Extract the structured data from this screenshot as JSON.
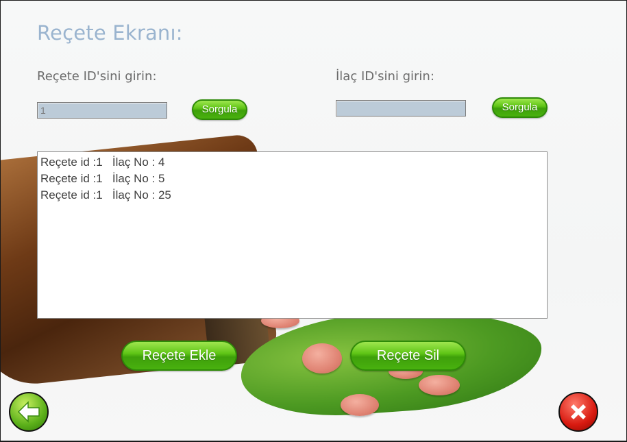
{
  "screen": {
    "title": "Reçete Ekranı:"
  },
  "prescription_query": {
    "label": "Reçete ID'sini girin:",
    "value": "1",
    "button_label": "Sorgula"
  },
  "drug_query": {
    "label": "İlaç ID'sini girin:",
    "value": "",
    "button_label": "Sorgula"
  },
  "results": [
    "Reçete id :1   İlaç No : 4",
    "Reçete id :1   İlaç No : 5",
    "Reçete id :1   İlaç No : 25"
  ],
  "actions": {
    "add_label": "Reçete Ekle",
    "delete_label": "Reçete Sil"
  },
  "icons": {
    "back": "back-arrow-icon",
    "close": "close-icon"
  },
  "colors": {
    "title": "#9ab4cf",
    "button_green": "#4fb414",
    "input_bg": "#bccbd8",
    "close_red": "#d81a10"
  }
}
